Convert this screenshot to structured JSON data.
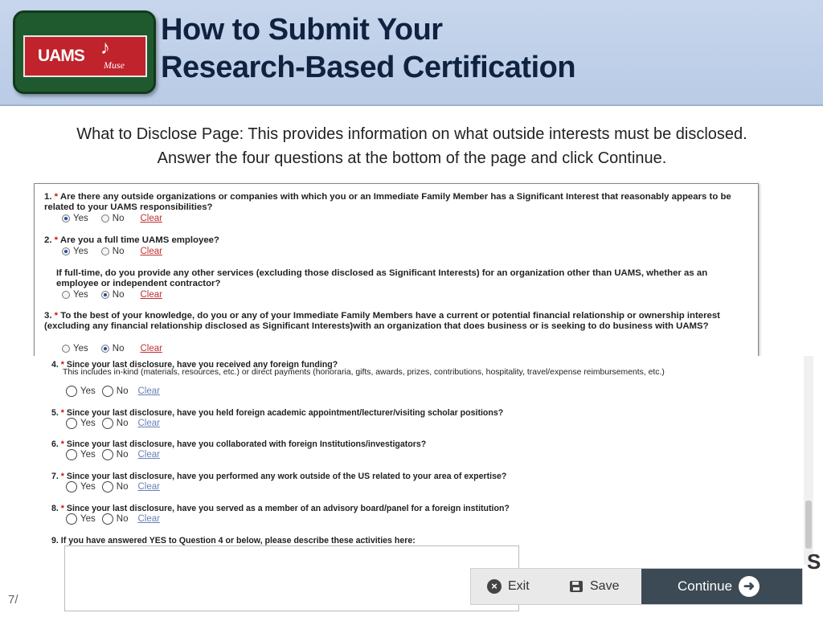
{
  "header": {
    "logo_text": "UAMS",
    "logo_sub": "Muse",
    "title_line1": "How to Submit Your",
    "title_line2": "Research-Based Certification"
  },
  "description": "What to Disclose Page:  This provides information on what outside interests must be disclosed.  Answer the four questions at the bottom of the page and click Continue.",
  "form1": {
    "q1": {
      "num": "1.",
      "req": "*",
      "text": "Are there any outside organizations or companies with which you or an Immediate Family Member has a Significant Interest that reasonably appears to be related to your UAMS responsibilities?",
      "yes": "Yes",
      "no": "No",
      "clear": "Clear",
      "selected": "Yes"
    },
    "q2": {
      "num": "2.",
      "req": "*",
      "text": "Are you a full time UAMS employee?",
      "yes": "Yes",
      "no": "No",
      "clear": "Clear",
      "selected": "Yes"
    },
    "q2b": {
      "text": "If full-time, do you provide any other services (excluding those disclosed as Significant Interests) for an organization other than UAMS, whether as an employee or independent contractor?",
      "yes": "Yes",
      "no": "No",
      "clear": "Clear",
      "selected": "No"
    },
    "q3": {
      "num": "3.",
      "req": "*",
      "text": "To the best of your knowledge, do you or any of your Immediate Family Members have a current or potential financial relationship or ownership interest (excluding any financial relationship disclosed as Significant Interests)with an organization that does business or is seeking to do business with UAMS?",
      "yes": "Yes",
      "no": "No",
      "clear": "Clear",
      "selected": "No"
    }
  },
  "form2": {
    "q4": {
      "num": "4.",
      "req": "*",
      "text": "Since your last disclosure, have you received any foreign funding?",
      "sub": "This includes in-kind (materials, resources, etc.) or direct payments (honoraria, gifts, awards, prizes, contributions, hospitality, travel/expense reimbursements, etc.)",
      "yes": "Yes",
      "no": "No",
      "clear": "Clear"
    },
    "q5": {
      "num": "5.",
      "req": "*",
      "text": "Since your last disclosure, have you held foreign academic appointment/lecturer/visiting scholar positions?",
      "yes": "Yes",
      "no": "No",
      "clear": "Clear"
    },
    "q6": {
      "num": "6.",
      "req": "*",
      "text": "Since your last disclosure, have you collaborated with foreign Institutions/investigators?",
      "yes": "Yes",
      "no": "No",
      "clear": "Clear"
    },
    "q7": {
      "num": "7.",
      "req": "*",
      "text": "Since your last disclosure, have you performed any work outside of the US related to your area of expertise?",
      "yes": "Yes",
      "no": "No",
      "clear": "Clear"
    },
    "q8": {
      "num": "8.",
      "req": "*",
      "text": "Since your last disclosure, have you served as a member of an advisory board/panel for a foreign institution?",
      "yes": "Yes",
      "no": "No",
      "clear": "Clear"
    },
    "q9": {
      "num": "9.",
      "text": "If you have answered YES to Question 4 or below, please describe these activities here:"
    }
  },
  "buttons": {
    "exit": "Exit",
    "save": "Save",
    "continue": "Continue"
  },
  "page_number": "7/",
  "colors": {
    "header_bg": "#c7d6ec",
    "title": "#0f2240",
    "required": "#d01010",
    "continue_bg": "#3c4a55"
  }
}
